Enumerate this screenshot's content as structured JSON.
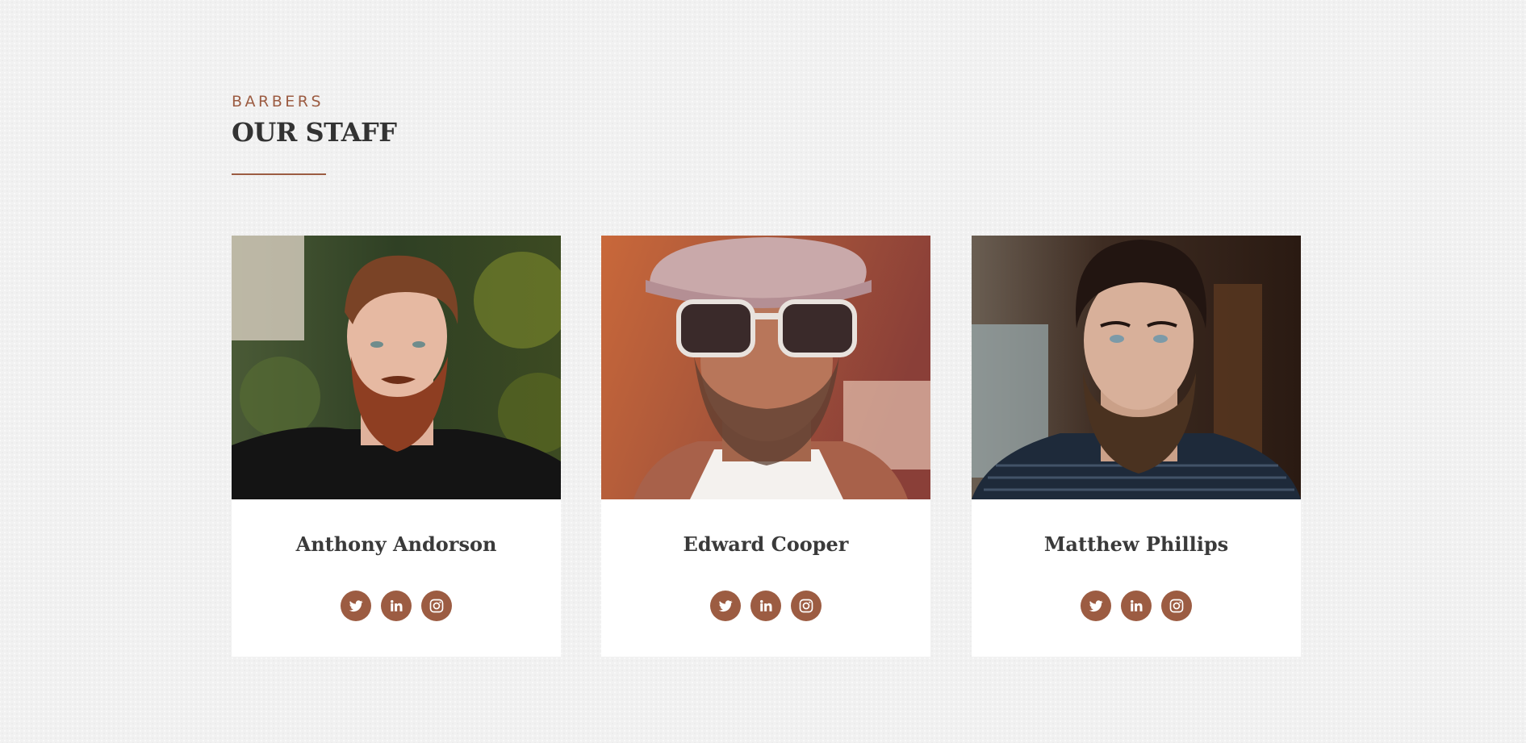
{
  "section": {
    "eyebrow": "BARBERS",
    "title": "OUR STAFF"
  },
  "colors": {
    "accent": "#9c5c42",
    "heading": "#333333",
    "background": "#f1f1f1",
    "card": "#ffffff"
  },
  "staff": [
    {
      "name": "Anthony Andorson",
      "photo": "portrait-red-beard-man",
      "socials": [
        "twitter-icon",
        "linkedin-icon",
        "instagram-icon"
      ]
    },
    {
      "name": "Edward Cooper",
      "photo": "portrait-man-cap-sunglasses",
      "socials": [
        "twitter-icon",
        "linkedin-icon",
        "instagram-icon"
      ]
    },
    {
      "name": "Matthew Phillips",
      "photo": "portrait-dark-beard-man",
      "socials": [
        "twitter-icon",
        "linkedin-icon",
        "instagram-icon"
      ]
    }
  ]
}
